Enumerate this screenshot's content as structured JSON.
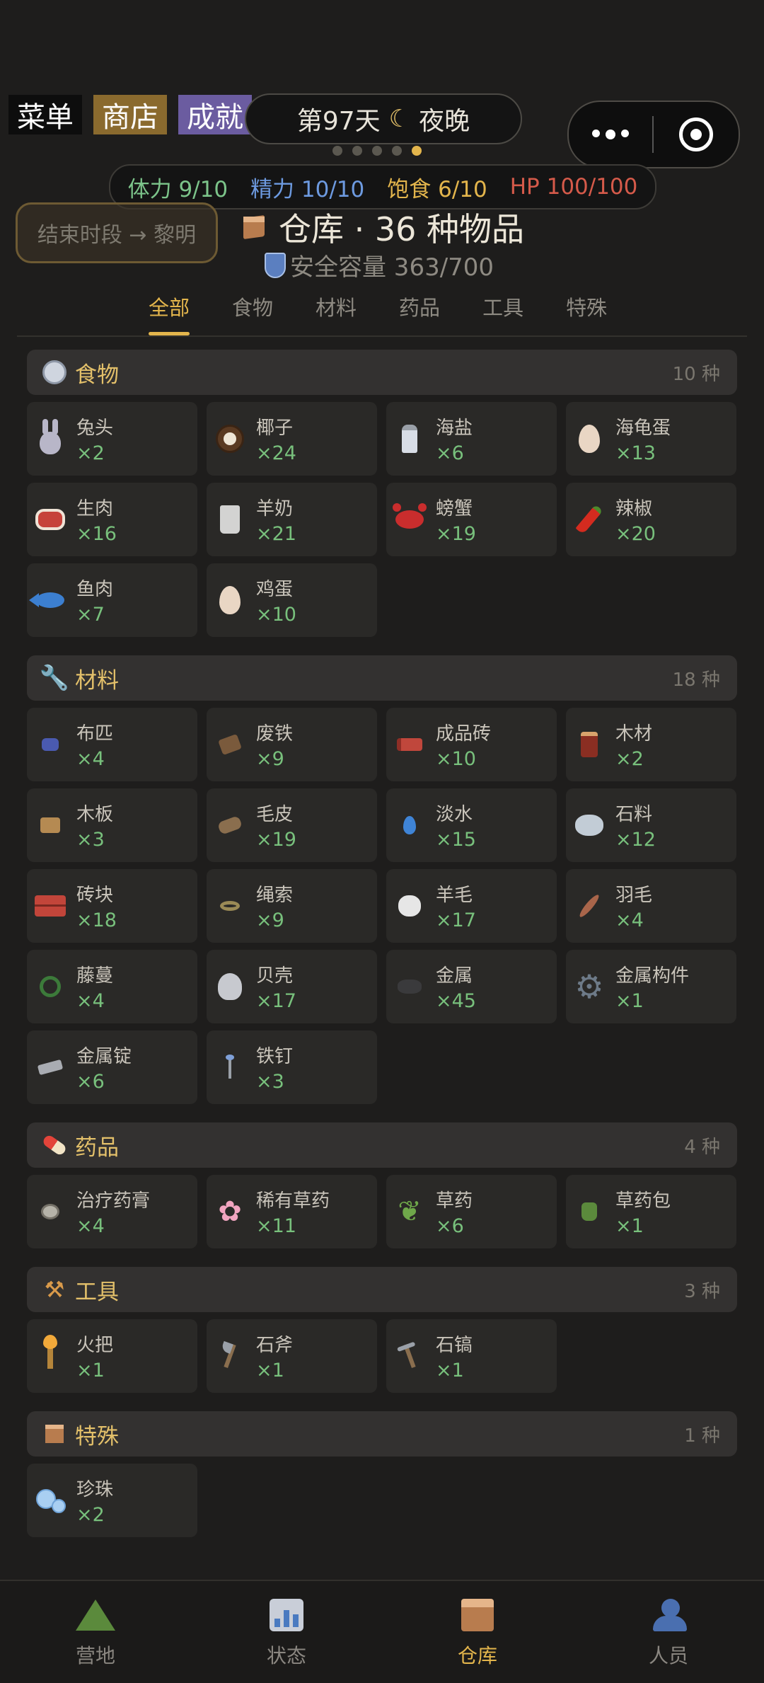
{
  "topbar": {
    "menu": "菜单",
    "shop": "商店",
    "achievements": "成就"
  },
  "day": {
    "label": "第97天",
    "moon": "☾",
    "period": "夜晚"
  },
  "stats": {
    "stamina": "体力 9/10",
    "energy": "精力 10/10",
    "satiety": "饱食 6/10",
    "hp": "HP 100/100"
  },
  "end_button": "结束时段 → 黎明",
  "warehouse": {
    "title": "仓库 · 36 种物品",
    "capacity": "安全容量 363/700"
  },
  "tabs": [
    "全部",
    "食物",
    "材料",
    "药品",
    "工具",
    "特殊"
  ],
  "sections": [
    {
      "title": "食物",
      "count": "10 种",
      "items": [
        {
          "name": "兔头",
          "qty": "×2"
        },
        {
          "name": "椰子",
          "qty": "×24"
        },
        {
          "name": "海盐",
          "qty": "×6"
        },
        {
          "name": "海龟蛋",
          "qty": "×13"
        },
        {
          "name": "生肉",
          "qty": "×16"
        },
        {
          "name": "羊奶",
          "qty": "×21"
        },
        {
          "name": "螃蟹",
          "qty": "×19"
        },
        {
          "name": "辣椒",
          "qty": "×20"
        },
        {
          "name": "鱼肉",
          "qty": "×7"
        },
        {
          "name": "鸡蛋",
          "qty": "×10"
        }
      ]
    },
    {
      "title": "材料",
      "count": "18 种",
      "items": [
        {
          "name": "布匹",
          "qty": "×4"
        },
        {
          "name": "废铁",
          "qty": "×9"
        },
        {
          "name": "成品砖",
          "qty": "×10"
        },
        {
          "name": "木材",
          "qty": "×2"
        },
        {
          "name": "木板",
          "qty": "×3"
        },
        {
          "name": "毛皮",
          "qty": "×19"
        },
        {
          "name": "淡水",
          "qty": "×15"
        },
        {
          "name": "石料",
          "qty": "×12"
        },
        {
          "name": "砖块",
          "qty": "×18"
        },
        {
          "name": "绳索",
          "qty": "×9"
        },
        {
          "name": "羊毛",
          "qty": "×17"
        },
        {
          "name": "羽毛",
          "qty": "×4"
        },
        {
          "name": "藤蔓",
          "qty": "×4"
        },
        {
          "name": "贝壳",
          "qty": "×17"
        },
        {
          "name": "金属",
          "qty": "×45"
        },
        {
          "name": "金属构件",
          "qty": "×1"
        },
        {
          "name": "金属锭",
          "qty": "×6"
        },
        {
          "name": "铁钉",
          "qty": "×3"
        }
      ]
    },
    {
      "title": "药品",
      "count": "4 种",
      "items": [
        {
          "name": "治疗药膏",
          "qty": "×4"
        },
        {
          "name": "稀有草药",
          "qty": "×11"
        },
        {
          "name": "草药",
          "qty": "×6"
        },
        {
          "name": "草药包",
          "qty": "×1"
        }
      ]
    },
    {
      "title": "工具",
      "count": "3 种",
      "items": [
        {
          "name": "火把",
          "qty": "×1"
        },
        {
          "name": "石斧",
          "qty": "×1"
        },
        {
          "name": "石镐",
          "qty": "×1"
        }
      ]
    },
    {
      "title": "特殊",
      "count": "1 种",
      "items": [
        {
          "name": "珍珠",
          "qty": "×2"
        }
      ]
    }
  ],
  "nav": [
    "营地",
    "状态",
    "仓库",
    "人员"
  ],
  "gear_glyph": "⚙",
  "flower_glyph": "✿",
  "herb_glyph": "❦",
  "wrench_glyph": "🔧",
  "tools_glyph": "⚒",
  "colors": {
    "accent": "#e3b54c",
    "qty": "#78c07c",
    "hp": "#d55a4a",
    "energy": "#6d9ae0",
    "stamina": "#7cc48a"
  }
}
